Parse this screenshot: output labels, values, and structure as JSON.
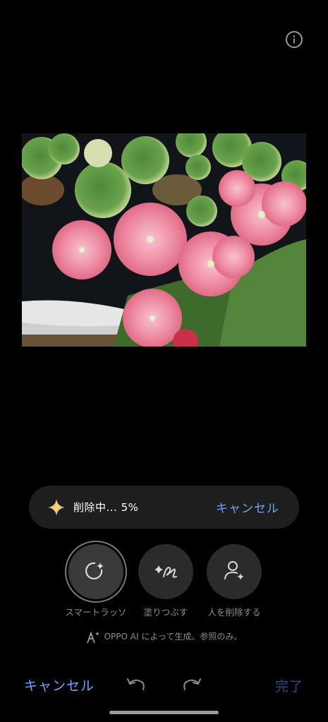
{
  "info_icon": "info-circle-icon",
  "photo": {
    "subject": "pink-petunias-and-geranium-leaves"
  },
  "progress": {
    "label": "削除中... 5%",
    "percent": 5,
    "cancel_label": "キャンセル",
    "icon": "sparkle-icon"
  },
  "tools": [
    {
      "label": "スマートラッソ",
      "icon": "smart-lasso-icon",
      "selected": true
    },
    {
      "label": "塗りつぶす",
      "icon": "brush-scribble-icon",
      "selected": false
    },
    {
      "label": "人を削除する",
      "icon": "remove-person-icon",
      "selected": false
    }
  ],
  "ai_note": "OPPO AI によって生成。参照のみ。",
  "bottom_bar": {
    "cancel_label": "キャンセル",
    "done_label": "完了",
    "undo_icon": "undo-icon",
    "redo_icon": "redo-icon"
  },
  "colors": {
    "accent": "#6fa3ff",
    "background": "#000000",
    "done_disabled": "#2a4f8a"
  }
}
